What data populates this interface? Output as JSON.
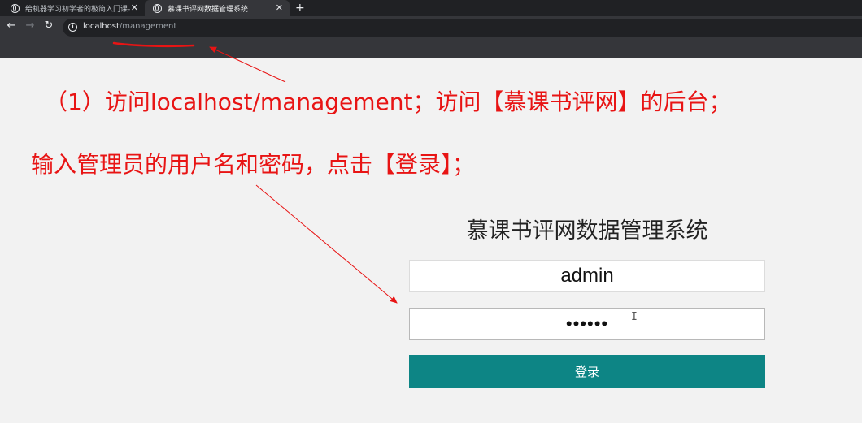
{
  "browser": {
    "tabs": [
      {
        "title": "给机器学习初学者的极简入门课-"
      },
      {
        "title": "慕课书评网数据管理系统"
      }
    ],
    "new_tab": "+",
    "url_host": "localhost",
    "url_path": "/management"
  },
  "annotations": {
    "line1": "（1）访问localhost/management；访问【慕课书评网】的后台；",
    "line2": "输入管理员的用户名和密码，点击【登录】；"
  },
  "login": {
    "title": "慕课书评网数据管理系统",
    "username_value": "admin",
    "password_value": "••••••",
    "submit_label": "登录"
  },
  "colors": {
    "accent": "#0d8585",
    "annotation": "#e81414"
  }
}
